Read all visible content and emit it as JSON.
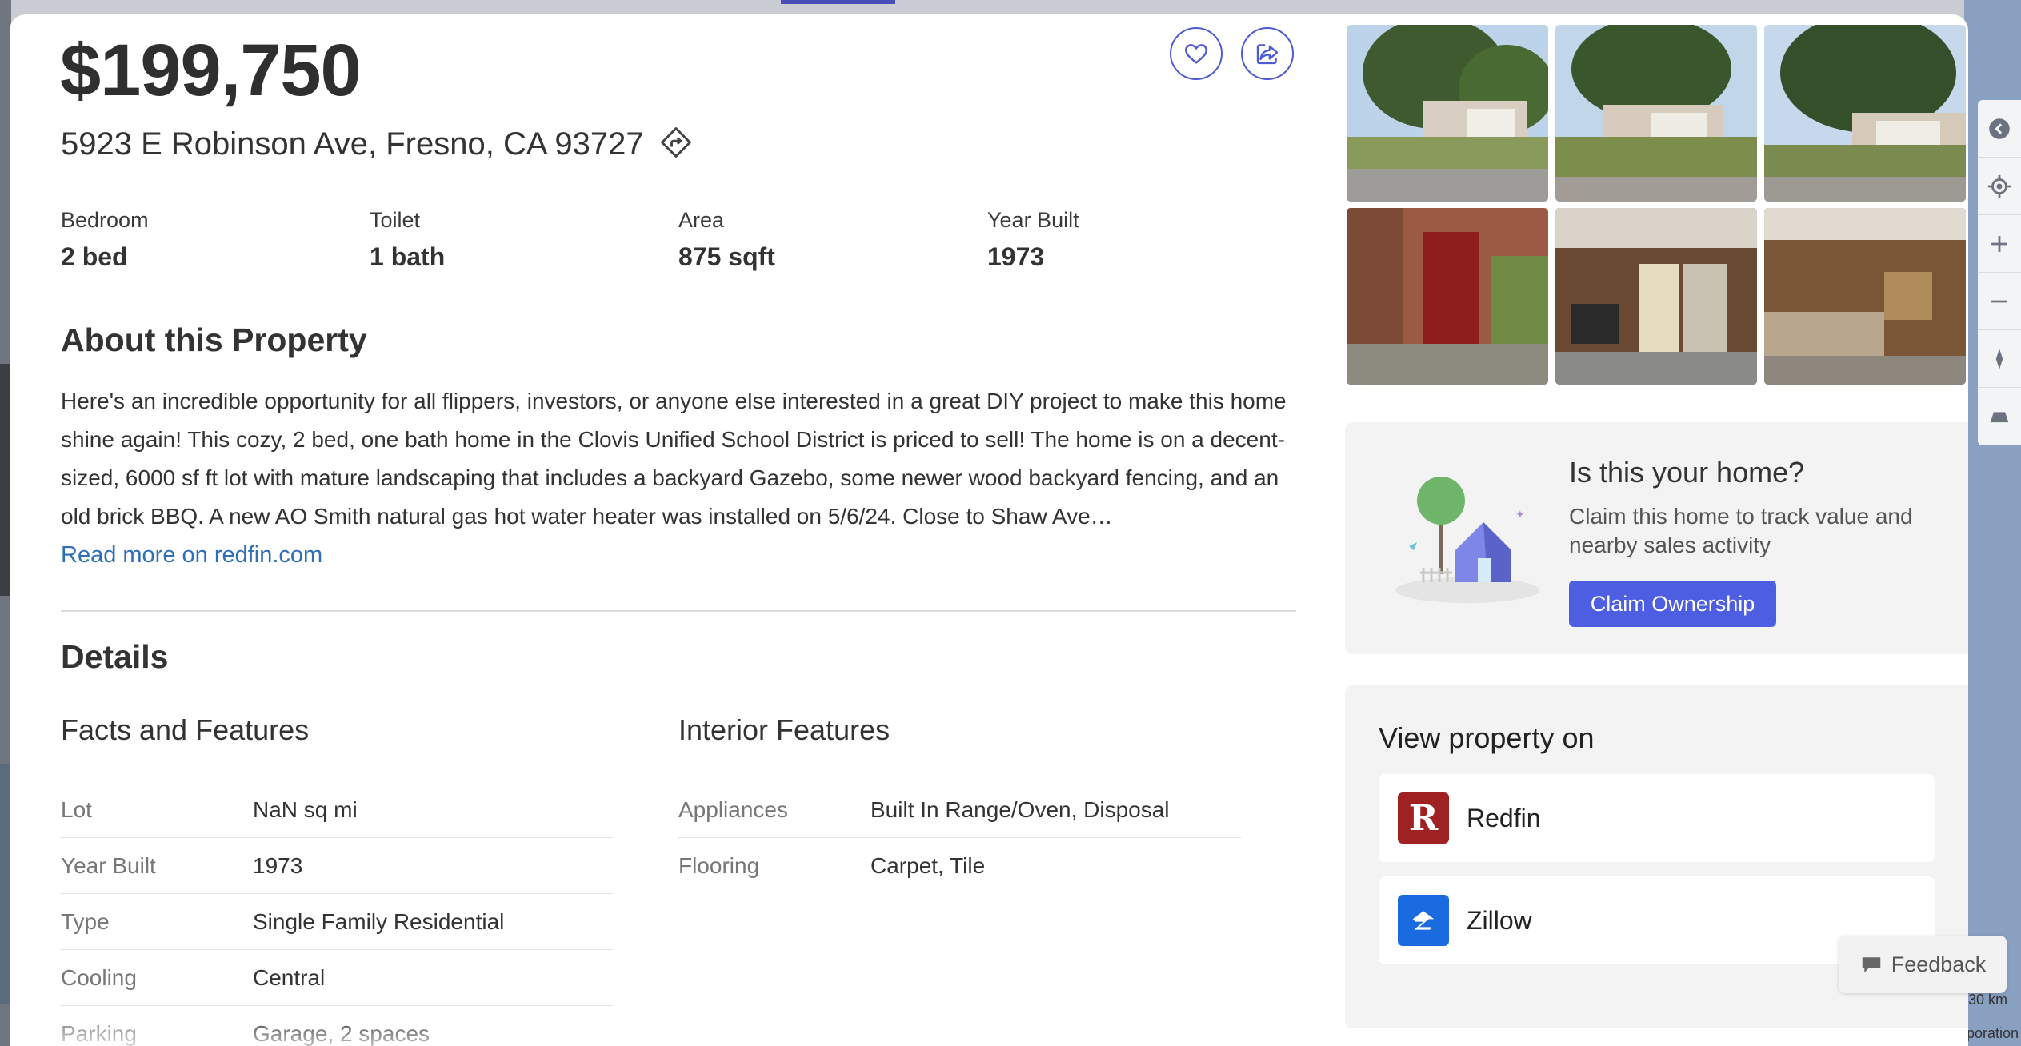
{
  "listing": {
    "price": "$199,750",
    "address": "5923 E Robinson Ave, Fresno, CA 93727"
  },
  "stats": [
    {
      "label": "Bedroom",
      "value": "2 bed"
    },
    {
      "label": "Toilet",
      "value": "1 bath"
    },
    {
      "label": "Area",
      "value": "875 sqft"
    },
    {
      "label": "Year Built",
      "value": "1973"
    }
  ],
  "about": {
    "heading": "About this Property",
    "text": "Here's an incredible opportunity for all flippers, investors, or anyone else interested in a great DIY project to make this home shine again! This cozy, 2 bed, one bath home in the Clovis Unified School District is priced to sell! The home is on a decent-sized, 6000 sf ft lot with mature landscaping that includes a backyard Gazebo, some newer wood backyard fencing, and an old brick BBQ. A new AO Smith natural gas hot water heater was installed on 5/6/24. Close to Shaw Ave…",
    "read_more": "Read more on redfin.com"
  },
  "details": {
    "heading": "Details",
    "facts_title": "Facts and Features",
    "facts": [
      {
        "key": "Lot",
        "value": "NaN sq mi"
      },
      {
        "key": "Year Built",
        "value": "1973"
      },
      {
        "key": "Type",
        "value": "Single Family Residential"
      },
      {
        "key": "Cooling",
        "value": "Central"
      },
      {
        "key": "Parking",
        "value": "Garage, 2 spaces"
      }
    ],
    "interior_title": "Interior Features",
    "interior": [
      {
        "key": "Appliances",
        "value": "Built In Range/Oven, Disposal"
      },
      {
        "key": "Flooring",
        "value": "Carpet, Tile"
      }
    ]
  },
  "claim": {
    "title": "Is this your home?",
    "subtitle": "Claim this home to track value and nearby sales activity",
    "button": "Claim Ownership"
  },
  "view_on": {
    "title": "View property on",
    "sites": [
      {
        "name": "Redfin",
        "logo_letter": "R",
        "color": "#a02121"
      },
      {
        "name": "Zillow",
        "color": "#1a6be0"
      }
    ]
  },
  "feedback": "Feedback",
  "map": {
    "scale": "30 km",
    "attribution": "poration"
  },
  "icons": {
    "favorite": "heart-icon",
    "share": "share-icon",
    "directions": "directions-icon"
  },
  "colors": {
    "accent": "#4d5ee3",
    "link": "#2f6fb5"
  }
}
